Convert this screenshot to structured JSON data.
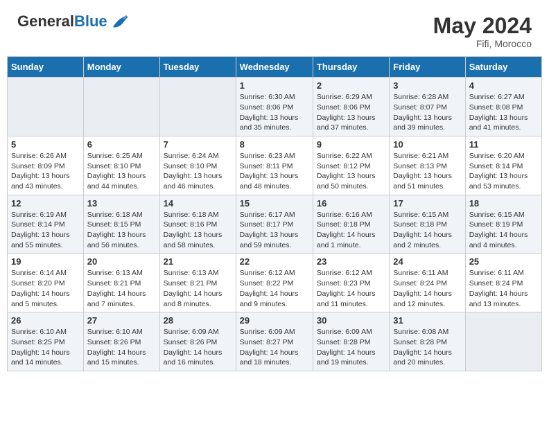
{
  "header": {
    "logo_general": "General",
    "logo_blue": "Blue",
    "month_year": "May 2024",
    "location": "Fifi, Morocco"
  },
  "weekdays": [
    "Sunday",
    "Monday",
    "Tuesday",
    "Wednesday",
    "Thursday",
    "Friday",
    "Saturday"
  ],
  "weeks": [
    [
      {
        "day": "",
        "info": ""
      },
      {
        "day": "",
        "info": ""
      },
      {
        "day": "",
        "info": ""
      },
      {
        "day": "1",
        "info": "Sunrise: 6:30 AM\nSunset: 8:06 PM\nDaylight: 13 hours\nand 35 minutes."
      },
      {
        "day": "2",
        "info": "Sunrise: 6:29 AM\nSunset: 8:06 PM\nDaylight: 13 hours\nand 37 minutes."
      },
      {
        "day": "3",
        "info": "Sunrise: 6:28 AM\nSunset: 8:07 PM\nDaylight: 13 hours\nand 39 minutes."
      },
      {
        "day": "4",
        "info": "Sunrise: 6:27 AM\nSunset: 8:08 PM\nDaylight: 13 hours\nand 41 minutes."
      }
    ],
    [
      {
        "day": "5",
        "info": "Sunrise: 6:26 AM\nSunset: 8:09 PM\nDaylight: 13 hours\nand 43 minutes."
      },
      {
        "day": "6",
        "info": "Sunrise: 6:25 AM\nSunset: 8:10 PM\nDaylight: 13 hours\nand 44 minutes."
      },
      {
        "day": "7",
        "info": "Sunrise: 6:24 AM\nSunset: 8:10 PM\nDaylight: 13 hours\nand 46 minutes."
      },
      {
        "day": "8",
        "info": "Sunrise: 6:23 AM\nSunset: 8:11 PM\nDaylight: 13 hours\nand 48 minutes."
      },
      {
        "day": "9",
        "info": "Sunrise: 6:22 AM\nSunset: 8:12 PM\nDaylight: 13 hours\nand 50 minutes."
      },
      {
        "day": "10",
        "info": "Sunrise: 6:21 AM\nSunset: 8:13 PM\nDaylight: 13 hours\nand 51 minutes."
      },
      {
        "day": "11",
        "info": "Sunrise: 6:20 AM\nSunset: 8:14 PM\nDaylight: 13 hours\nand 53 minutes."
      }
    ],
    [
      {
        "day": "12",
        "info": "Sunrise: 6:19 AM\nSunset: 8:14 PM\nDaylight: 13 hours\nand 55 minutes."
      },
      {
        "day": "13",
        "info": "Sunrise: 6:18 AM\nSunset: 8:15 PM\nDaylight: 13 hours\nand 56 minutes."
      },
      {
        "day": "14",
        "info": "Sunrise: 6:18 AM\nSunset: 8:16 PM\nDaylight: 13 hours\nand 58 minutes."
      },
      {
        "day": "15",
        "info": "Sunrise: 6:17 AM\nSunset: 8:17 PM\nDaylight: 13 hours\nand 59 minutes."
      },
      {
        "day": "16",
        "info": "Sunrise: 6:16 AM\nSunset: 8:18 PM\nDaylight: 14 hours\nand 1 minute."
      },
      {
        "day": "17",
        "info": "Sunrise: 6:15 AM\nSunset: 8:18 PM\nDaylight: 14 hours\nand 2 minutes."
      },
      {
        "day": "18",
        "info": "Sunrise: 6:15 AM\nSunset: 8:19 PM\nDaylight: 14 hours\nand 4 minutes."
      }
    ],
    [
      {
        "day": "19",
        "info": "Sunrise: 6:14 AM\nSunset: 8:20 PM\nDaylight: 14 hours\nand 5 minutes."
      },
      {
        "day": "20",
        "info": "Sunrise: 6:13 AM\nSunset: 8:21 PM\nDaylight: 14 hours\nand 7 minutes."
      },
      {
        "day": "21",
        "info": "Sunrise: 6:13 AM\nSunset: 8:21 PM\nDaylight: 14 hours\nand 8 minutes."
      },
      {
        "day": "22",
        "info": "Sunrise: 6:12 AM\nSunset: 8:22 PM\nDaylight: 14 hours\nand 9 minutes."
      },
      {
        "day": "23",
        "info": "Sunrise: 6:12 AM\nSunset: 8:23 PM\nDaylight: 14 hours\nand 11 minutes."
      },
      {
        "day": "24",
        "info": "Sunrise: 6:11 AM\nSunset: 8:24 PM\nDaylight: 14 hours\nand 12 minutes."
      },
      {
        "day": "25",
        "info": "Sunrise: 6:11 AM\nSunset: 8:24 PM\nDaylight: 14 hours\nand 13 minutes."
      }
    ],
    [
      {
        "day": "26",
        "info": "Sunrise: 6:10 AM\nSunset: 8:25 PM\nDaylight: 14 hours\nand 14 minutes."
      },
      {
        "day": "27",
        "info": "Sunrise: 6:10 AM\nSunset: 8:26 PM\nDaylight: 14 hours\nand 15 minutes."
      },
      {
        "day": "28",
        "info": "Sunrise: 6:09 AM\nSunset: 8:26 PM\nDaylight: 14 hours\nand 16 minutes."
      },
      {
        "day": "29",
        "info": "Sunrise: 6:09 AM\nSunset: 8:27 PM\nDaylight: 14 hours\nand 18 minutes."
      },
      {
        "day": "30",
        "info": "Sunrise: 6:09 AM\nSunset: 8:28 PM\nDaylight: 14 hours\nand 19 minutes."
      },
      {
        "day": "31",
        "info": "Sunrise: 6:08 AM\nSunset: 8:28 PM\nDaylight: 14 hours\nand 20 minutes."
      },
      {
        "day": "",
        "info": ""
      }
    ]
  ]
}
